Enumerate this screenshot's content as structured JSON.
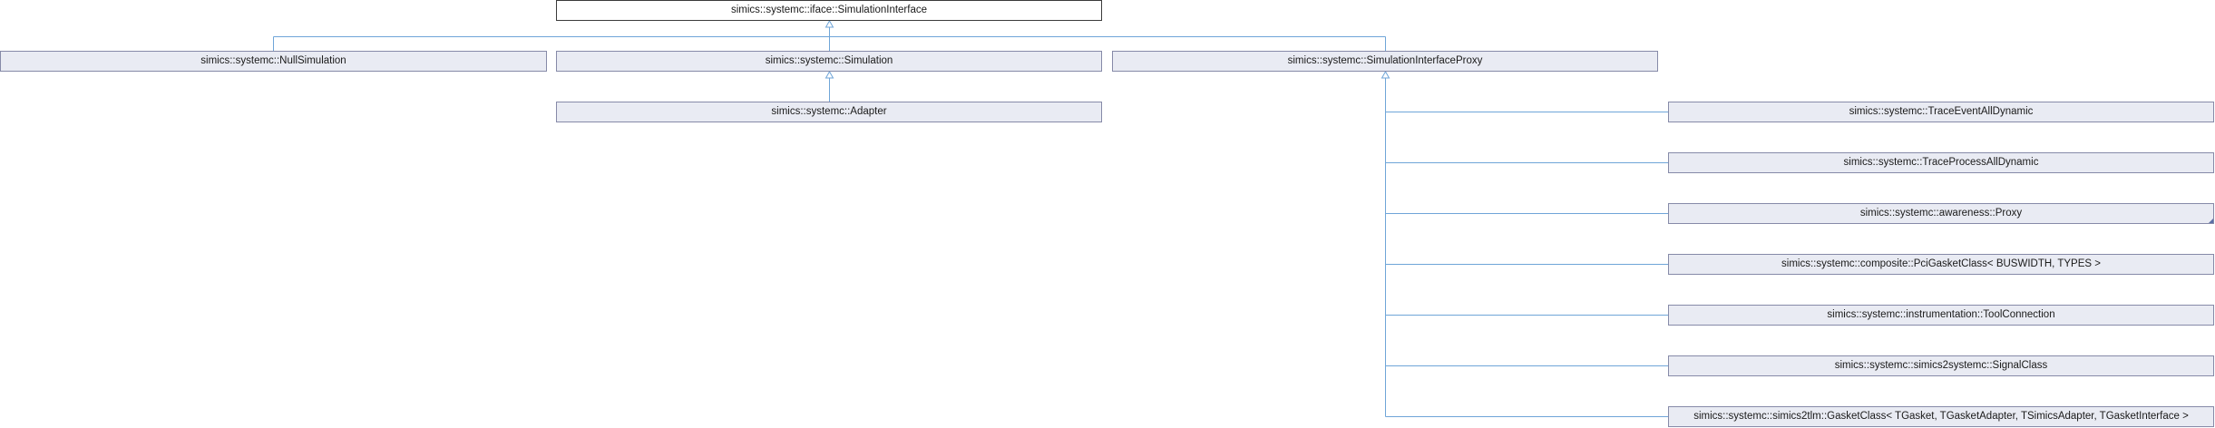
{
  "diagram": {
    "root": "simics::systemc::iface::SimulationInterface",
    "level1": [
      "simics::systemc::NullSimulation",
      "simics::systemc::Simulation",
      "simics::systemc::SimulationInterfaceProxy"
    ],
    "adapter": "simics::systemc::Adapter",
    "proxy_children": [
      "simics::systemc::TraceEventAllDynamic",
      "simics::systemc::TraceProcessAllDynamic",
      "simics::systemc::awareness::Proxy",
      "simics::systemc::composite::PciGasketClass< BUSWIDTH, TYPES >",
      "simics::systemc::instrumentation::ToolConnection",
      "simics::systemc::simics2systemc::SignalClass",
      "simics::systemc::simics2tlm::GasketClass< TGasket, TGasketAdapter, TSimicsAdapter, TGasketInterface >"
    ],
    "edge_color": "#6fa5d8"
  }
}
